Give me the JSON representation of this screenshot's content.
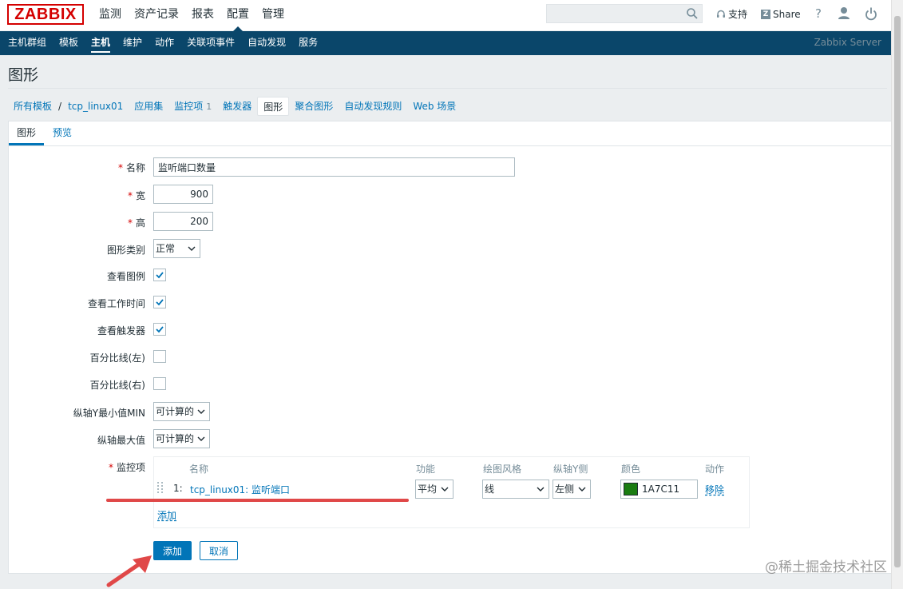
{
  "header": {
    "logo": "ZABBIX",
    "menu": [
      {
        "label": "监测",
        "active": false
      },
      {
        "label": "资产记录",
        "active": false
      },
      {
        "label": "报表",
        "active": false
      },
      {
        "label": "配置",
        "active": true
      },
      {
        "label": "管理",
        "active": false
      }
    ],
    "search": {
      "value": "",
      "placeholder": ""
    },
    "support_label": "支持",
    "share_label": "Share",
    "help_label": "?"
  },
  "submenu": {
    "items": [
      {
        "label": "主机群组",
        "active": false
      },
      {
        "label": "模板",
        "active": false
      },
      {
        "label": "主机",
        "active": true
      },
      {
        "label": "维护",
        "active": false
      },
      {
        "label": "动作",
        "active": false
      },
      {
        "label": "关联项事件",
        "active": false
      },
      {
        "label": "自动发现",
        "active": false
      },
      {
        "label": "服务",
        "active": false
      }
    ],
    "server_name": "Zabbix Server"
  },
  "page": {
    "title": "图形"
  },
  "host_nav": {
    "items": [
      {
        "label": "所有模板"
      },
      {
        "label": "tcp_linux01"
      },
      {
        "label": "应用集"
      },
      {
        "label": "监控项",
        "count": "1"
      },
      {
        "label": "触发器"
      },
      {
        "label": "图形",
        "selected": true
      },
      {
        "label": "聚合图形"
      },
      {
        "label": "自动发现规则"
      },
      {
        "label": "Web 场景"
      }
    ],
    "separator": "/"
  },
  "tabs": [
    {
      "label": "图形",
      "active": true
    },
    {
      "label": "预览",
      "active": false
    }
  ],
  "form": {
    "name": {
      "label": "名称",
      "value": "监听端口数量",
      "required": true
    },
    "width": {
      "label": "宽",
      "value": "900",
      "required": true
    },
    "height": {
      "label": "高",
      "value": "200",
      "required": true
    },
    "graph_type": {
      "label": "图形类别",
      "value": "正常"
    },
    "show_legend": {
      "label": "查看图例",
      "checked": true
    },
    "show_working_time": {
      "label": "查看工作时间",
      "checked": true
    },
    "show_triggers": {
      "label": "查看触发器",
      "checked": true
    },
    "percentile_left": {
      "label": "百分比线(左)",
      "checked": false
    },
    "percentile_right": {
      "label": "百分比线(右)",
      "checked": false
    },
    "ymin": {
      "label": "纵轴Y最小值MIN",
      "value": "可计算的"
    },
    "ymax": {
      "label": "纵轴最大值",
      "value": "可计算的"
    },
    "items": {
      "label": "监控项",
      "required": true,
      "headers": {
        "name": "名称",
        "function": "功能",
        "draw_style": "绘图风格",
        "y_axis": "纵轴Y侧",
        "color": "颜色",
        "action": "动作"
      },
      "rows": [
        {
          "num": "1:",
          "name": "tcp_linux01: 监听端口",
          "function": "平均",
          "draw_style": "线",
          "y_axis": "左侧",
          "color": "1A7C11",
          "color_hex": "#1A7C11",
          "remove": "移除"
        }
      ],
      "add_label": "添加"
    },
    "submit_label": "添加",
    "cancel_label": "取消"
  },
  "watermark": "@稀土掘金技术社区"
}
